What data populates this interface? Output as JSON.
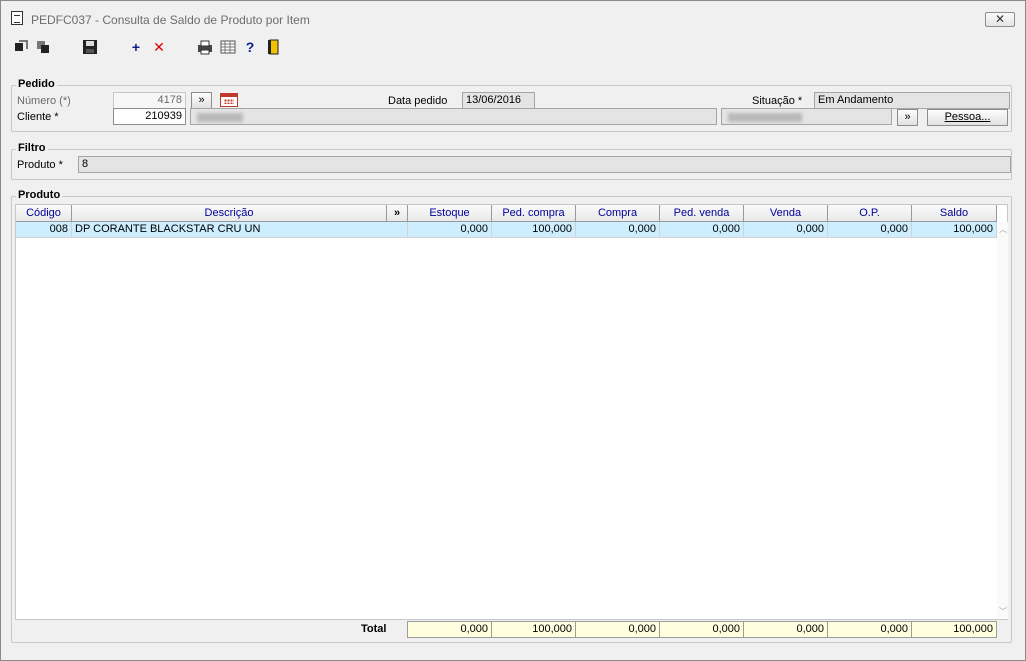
{
  "window": {
    "title": "PEDFC037 - Consulta de Saldo de Produto por Item",
    "close_glyph": "✕"
  },
  "toolbar": [
    {
      "name": "first-record-icon"
    },
    {
      "name": "last-record-icon"
    },
    {
      "name": "save-icon"
    },
    {
      "name": "add-icon",
      "glyph": "+",
      "color": "#0a1f8a"
    },
    {
      "name": "delete-icon",
      "glyph": "✕",
      "color": "#e00000"
    },
    {
      "name": "print-icon"
    },
    {
      "name": "spreadsheet-icon"
    },
    {
      "name": "help-icon",
      "glyph": "?",
      "color": "#0a1f8a"
    },
    {
      "name": "exit-icon"
    }
  ],
  "pedido": {
    "legend": "Pedido",
    "numero_label": "Número (*)",
    "numero_value": "4178",
    "lookup_glyph": "»",
    "data_pedido_label": "Data pedido",
    "data_pedido_value": "13/06/2016",
    "situacao_label": "Situação *",
    "situacao_value": "Em Andamento",
    "cliente_label": "Cliente *",
    "cliente_value": "210939",
    "pessoa_button": "Pessoa..."
  },
  "filtro": {
    "legend": "Filtro",
    "produto_label": "Produto *",
    "produto_value": "8"
  },
  "produto": {
    "legend": "Produto",
    "columns": [
      "Código",
      "Descrição",
      "»",
      "Estoque",
      "Ped. compra",
      "Compra",
      "Ped. venda",
      "Venda",
      "O.P.",
      "Saldo"
    ],
    "rows": [
      {
        "codigo": "008",
        "descricao": "DP CORANTE BLACKSTAR CRU UN",
        "estoque": "0,000",
        "ped_compra": "100,000",
        "compra": "0,000",
        "ped_venda": "0,000",
        "venda": "0,000",
        "op": "0,000",
        "saldo": "100,000"
      }
    ],
    "total_label": "Total",
    "totals": {
      "estoque": "0,000",
      "ped_compra": "100,000",
      "compra": "0,000",
      "ped_venda": "0,000",
      "venda": "0,000",
      "op": "0,000",
      "saldo": "100,000"
    }
  }
}
